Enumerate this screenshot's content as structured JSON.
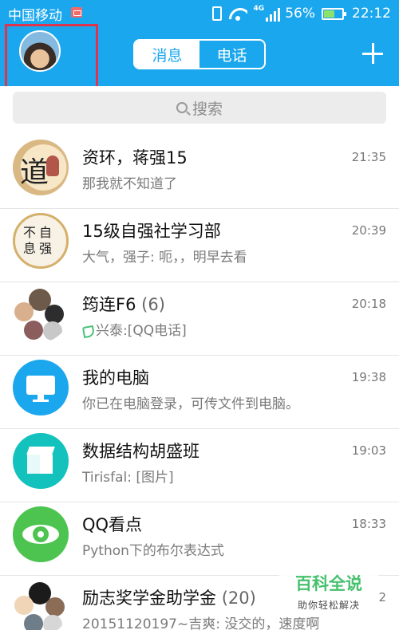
{
  "status_bar": {
    "carrier": "中国移动",
    "network_type": "4G",
    "battery": "56%",
    "time": "22:12",
    "icons": [
      "message-notification-icon",
      "vibrate-icon",
      "wifi-icon",
      "signal-icon",
      "battery-icon"
    ]
  },
  "header": {
    "tabs": [
      {
        "label": "消息",
        "active": true
      },
      {
        "label": "电话",
        "active": false
      }
    ],
    "add_icon": "plus-icon",
    "accent_color": "#1aa7ee",
    "highlight_color": "#e0334c"
  },
  "search": {
    "placeholder": "搜索"
  },
  "chats": [
    {
      "name": "资环，蒋强15",
      "count": "",
      "preview": "那我就不知道了",
      "time": "21:35",
      "avatar": "calligraphy-dao-avatar"
    },
    {
      "name": "15级自强社学习部",
      "count": "",
      "preview": "大气，强子: 呃，，明早去看",
      "time": "20:39",
      "avatar": "calligraphy-ziqiang-avatar"
    },
    {
      "name": "筠连F6",
      "count": "(6)",
      "preview": "兴泰:[QQ电话]",
      "time": "20:18",
      "avatar": "group-avatar"
    },
    {
      "name": "我的电脑",
      "count": "",
      "preview": "你已在电脑登录，可传文件到电脑。",
      "time": "19:38",
      "avatar": "computer-avatar"
    },
    {
      "name": "数据结构胡盛班",
      "count": "",
      "preview": "Tirisfal: [图片]",
      "time": "19:03",
      "avatar": "cube-avatar"
    },
    {
      "name": "QQ看点",
      "count": "",
      "preview": "Python下的布尔表达式",
      "time": "18:33",
      "avatar": "eye-avatar"
    },
    {
      "name": "励志奖学金助学金",
      "count": "(20)",
      "preview": "20151120197~吉爽: 没交的，速度啊",
      "time": "2",
      "avatar": "group-avatar"
    }
  ],
  "watermark": {
    "title": "百科全说",
    "subtitle": "助你轻松解决"
  }
}
